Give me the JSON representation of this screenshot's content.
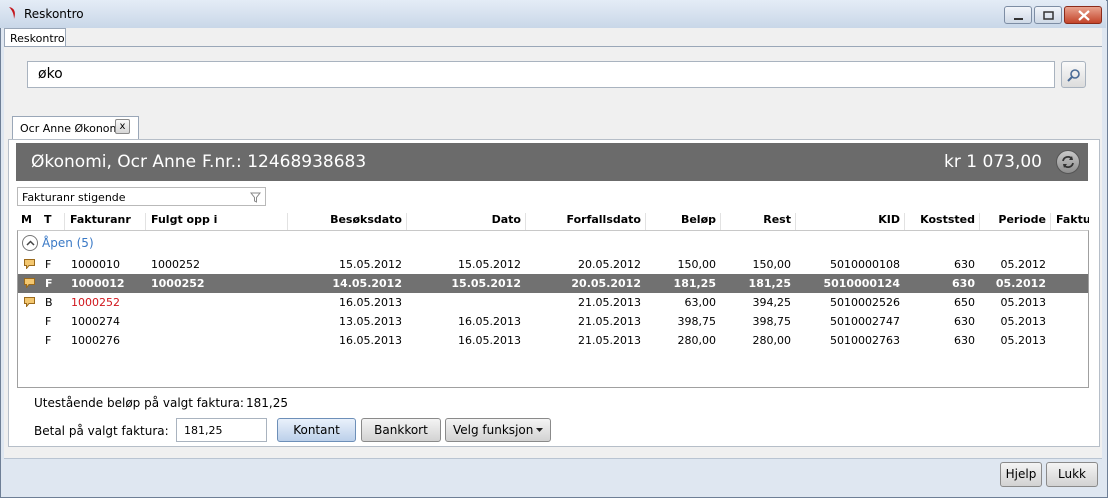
{
  "window": {
    "title": "Reskontro"
  },
  "top_tab": {
    "label": "Reskontro"
  },
  "search": {
    "value": "øko"
  },
  "customer_tab": {
    "label": "Ocr Anne Økonomi",
    "close": "x"
  },
  "customer": {
    "name": "Økonomi, Ocr Anne",
    "fnr": "F.nr.: 12468938683",
    "total": "kr 1 073,00"
  },
  "sort": {
    "selected": "Fakturanr stigende"
  },
  "columns": [
    "M",
    "T",
    "Fakturanr",
    "Fulgt opp i",
    "Besøksdato",
    "Dato",
    "Forfallsdato",
    "Beløp",
    "Rest",
    "KID",
    "Koststed",
    "Periode",
    "Faktu"
  ],
  "group": {
    "label": "Åpen (5)"
  },
  "rows": [
    {
      "note": true,
      "t": "F",
      "fakturanr": "1000010",
      "fulgt": "1000252",
      "besok": "15.05.2012",
      "dato": "15.05.2012",
      "forfall": "20.05.2012",
      "belop": "150,00",
      "rest": "150,00",
      "kid": "5010000108",
      "koststed": "630",
      "periode": "05.2012",
      "selected": false,
      "red": false
    },
    {
      "note": true,
      "t": "F",
      "fakturanr": "1000012",
      "fulgt": "1000252",
      "besok": "14.05.2012",
      "dato": "15.05.2012",
      "forfall": "20.05.2012",
      "belop": "181,25",
      "rest": "181,25",
      "kid": "5010000124",
      "koststed": "630",
      "periode": "05.2012",
      "selected": true,
      "red": false
    },
    {
      "note": true,
      "t": "B",
      "fakturanr": "1000252",
      "fulgt": "",
      "besok": "16.05.2013",
      "dato": "",
      "forfall": "21.05.2013",
      "belop": "63,00",
      "rest": "394,25",
      "kid": "5010002526",
      "koststed": "650",
      "periode": "05.2013",
      "selected": false,
      "red": true
    },
    {
      "note": false,
      "t": "F",
      "fakturanr": "1000274",
      "fulgt": "",
      "besok": "13.05.2013",
      "dato": "16.05.2013",
      "forfall": "21.05.2013",
      "belop": "398,75",
      "rest": "398,75",
      "kid": "5010002747",
      "koststed": "630",
      "periode": "05.2013",
      "selected": false,
      "red": false
    },
    {
      "note": false,
      "t": "F",
      "fakturanr": "1000276",
      "fulgt": "",
      "besok": "16.05.2013",
      "dato": "16.05.2013",
      "forfall": "21.05.2013",
      "belop": "280,00",
      "rest": "280,00",
      "kid": "5010002763",
      "koststed": "630",
      "periode": "05.2013",
      "selected": false,
      "red": false
    }
  ],
  "footer": {
    "outstanding_label": "Utestående beløp på valgt faktura:",
    "outstanding_value": "181,25",
    "pay_label": "Betal på valgt faktura:",
    "pay_value": "181,25",
    "kontant": "Kontant",
    "bankkort": "Bankkort",
    "velg": "Velg funksjon"
  },
  "buttons": {
    "hjelp": "Hjelp",
    "lukk": "Lukk"
  },
  "colors": {
    "header_bg": "#6b6b6b",
    "selected_row": "#717171",
    "group_text": "#3a79c6",
    "red_link": "#d0161c"
  }
}
